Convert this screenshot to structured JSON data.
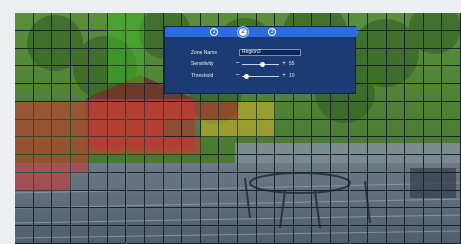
{
  "colors": {
    "frame_bg": "#eceff2",
    "grid_line": "#1b2230",
    "zone_green": "#3fb32a",
    "zone_red": "#d3342f",
    "zone_yellow": "#d6b72b",
    "unselected_blue": "#1f4f8f",
    "panel_bg": "#1d3b73",
    "panel_tab_bar": "#2d6cdf"
  },
  "panel": {
    "tabs": [
      {
        "label": "1",
        "active": false
      },
      {
        "label": "2",
        "active": true
      },
      {
        "label": "3",
        "active": false
      }
    ],
    "zone_name_label": "Zone Name",
    "zone_name_value": "Region3",
    "sensitivity_label": "Sensitivity",
    "sensitivity_value": "55",
    "threshold_label": "Threshold",
    "threshold_value": "10"
  },
  "grid": {
    "rows": 13,
    "cols": 24,
    "zones": {
      "green": [
        [
          0,
          5
        ],
        [
          0,
          6
        ],
        [
          1,
          5
        ],
        [
          1,
          6
        ],
        [
          2,
          5
        ],
        [
          2,
          6
        ],
        [
          3,
          5
        ],
        [
          3,
          6
        ]
      ],
      "red": [
        [
          5,
          0
        ],
        [
          5,
          1
        ],
        [
          5,
          2
        ],
        [
          5,
          3
        ],
        [
          5,
          4
        ],
        [
          5,
          5
        ],
        [
          5,
          6
        ],
        [
          5,
          7
        ],
        [
          5,
          8
        ],
        [
          5,
          9
        ],
        [
          5,
          10
        ],
        [
          5,
          11
        ],
        [
          6,
          0
        ],
        [
          6,
          1
        ],
        [
          6,
          2
        ],
        [
          6,
          3
        ],
        [
          6,
          4
        ],
        [
          6,
          5
        ],
        [
          6,
          6
        ],
        [
          6,
          7
        ],
        [
          7,
          0
        ],
        [
          7,
          1
        ],
        [
          7,
          2
        ],
        [
          7,
          3
        ],
        [
          7,
          4
        ],
        [
          7,
          5
        ],
        [
          7,
          6
        ],
        [
          7,
          7
        ],
        [
          7,
          8
        ],
        [
          7,
          9
        ],
        [
          8,
          0
        ],
        [
          8,
          1
        ],
        [
          8,
          2
        ],
        [
          8,
          3
        ],
        [
          9,
          0
        ],
        [
          9,
          1
        ],
        [
          9,
          2
        ]
      ],
      "yellow": [
        [
          5,
          12
        ],
        [
          5,
          13
        ],
        [
          6,
          10
        ],
        [
          6,
          11
        ],
        [
          6,
          12
        ],
        [
          6,
          13
        ]
      ]
    },
    "selected_region": {
      "row_start": 0,
      "row_end": 8,
      "col_start": 0,
      "col_end": 23
    }
  }
}
